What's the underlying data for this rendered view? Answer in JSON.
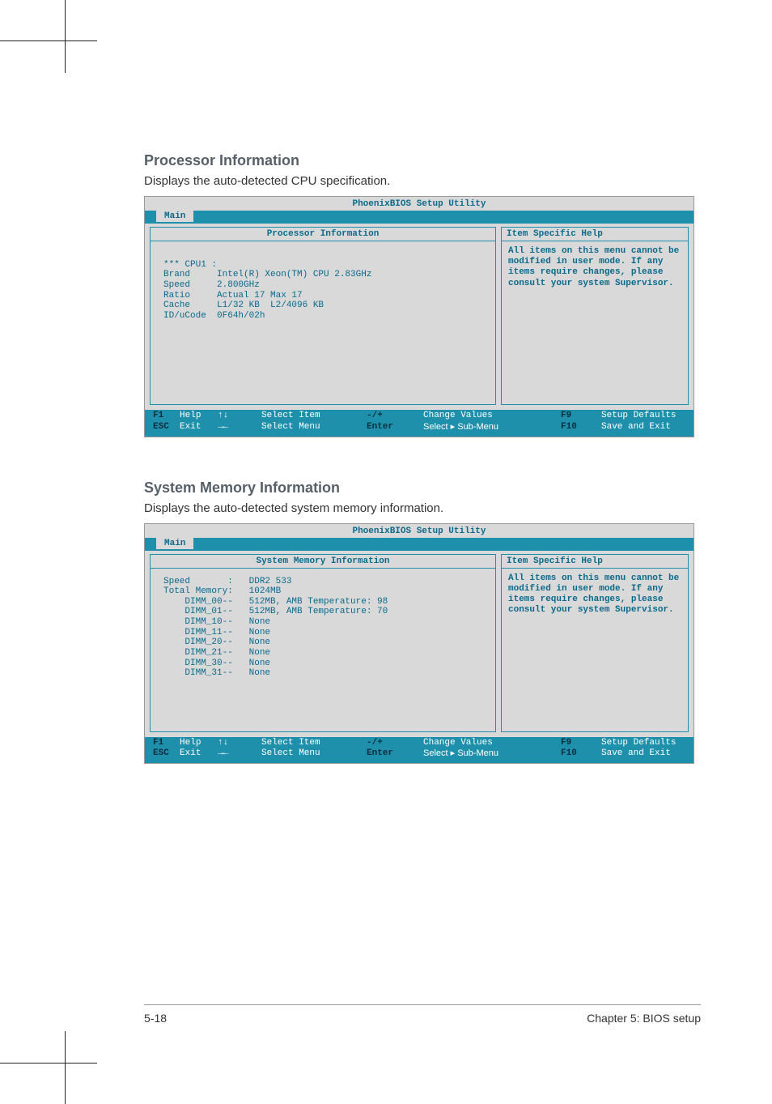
{
  "section1": {
    "heading": "Processor Information",
    "caption": "Displays the auto-detected CPU specification.",
    "bios": {
      "title": "PhoenixBIOS Setup Utility",
      "tab": "Main",
      "left_header": "Processor Information",
      "right_header": "Item Specific Help",
      "right_body": "All items on this menu cannot be modified in user mode. If any items require changes, please consult your system Supervisor.",
      "rows": [
        {
          "label": "*** CPU1 :",
          "value": ""
        },
        {
          "label": "Brand",
          "value": "Intel(R) Xeon(TM) CPU 2.83GHz"
        },
        {
          "label": "Speed",
          "value": "2.800GHz"
        },
        {
          "label": "Ratio",
          "value": "Actual 17 Max 17"
        },
        {
          "label": "Cache",
          "value": "L1/32 KB  L2/4096 KB"
        },
        {
          "label": "ID/uCode",
          "value": "0F64h/02h"
        }
      ]
    }
  },
  "section2": {
    "heading": "System Memory Information",
    "caption": "Displays the auto-detected system memory information.",
    "bios": {
      "title": "PhoenixBIOS Setup Utility",
      "tab": "Main",
      "left_header": "System Memory Information",
      "right_header": "Item Specific Help",
      "right_body": "All items on this menu cannot be modified in user mode. If any items require changes, please consult your system Supervisor.",
      "rows": [
        {
          "label": "Speed       :",
          "value": "DDR2 533"
        },
        {
          "label": "Total Memory:",
          "value": "1024MB"
        },
        {
          "label": "    DIMM_00--",
          "value": "512MB, AMB Temperature: 98"
        },
        {
          "label": "    DIMM_01--",
          "value": "512MB, AMB Temperature: 70"
        },
        {
          "label": "    DIMM_10--",
          "value": "None"
        },
        {
          "label": "    DIMM_11--",
          "value": "None"
        },
        {
          "label": "    DIMM_20--",
          "value": "None"
        },
        {
          "label": "    DIMM_21--",
          "value": "None"
        },
        {
          "label": "    DIMM_30--",
          "value": "None"
        },
        {
          "label": "    DIMM_31--",
          "value": "None"
        }
      ]
    }
  },
  "footer_keys": {
    "f1": "F1",
    "esc": "ESC",
    "help": "Help",
    "exit": "Exit",
    "updown": "↑↓",
    "leftright": "→←",
    "select_item": "Select Item",
    "select_menu": "Select Menu",
    "minusplus": "-/+",
    "enter": "Enter",
    "change_values": "Change Values",
    "select_sub": "Select ▸ Sub-Menu",
    "f9": "F9",
    "f10": "F10",
    "setup_defaults": "Setup Defaults",
    "save_exit": "Save and Exit"
  },
  "footer": {
    "page": "5-18",
    "chapter": "Chapter 5: BIOS setup"
  }
}
